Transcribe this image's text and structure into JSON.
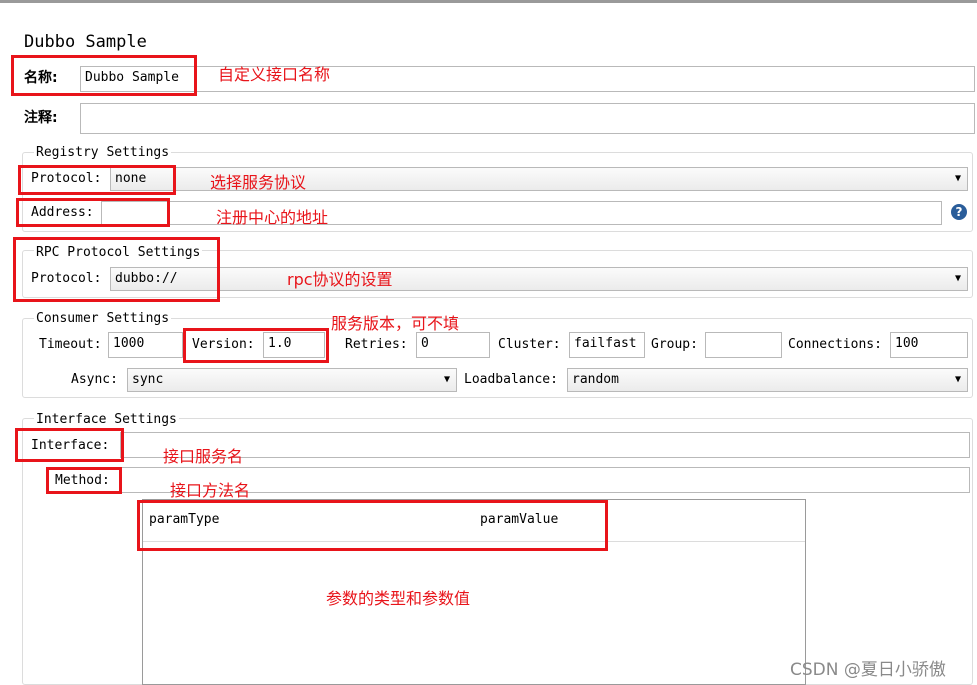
{
  "header": {
    "title": "Dubbo Sample"
  },
  "name": {
    "label": "名称:",
    "value": "Dubbo Sample"
  },
  "comment": {
    "label": "注释:",
    "value": ""
  },
  "registry": {
    "title": "Registry Settings",
    "protocol_label": "Protocol:",
    "protocol_value": "none",
    "address_label": "Address:",
    "address_value": ""
  },
  "rpc": {
    "title": "RPC Protocol Settings",
    "protocol_label": "Protocol:",
    "protocol_value": "dubbo://"
  },
  "consumer": {
    "title": "Consumer Settings",
    "timeout_label": "Timeout:",
    "timeout_value": "1000",
    "version_label": "Version:",
    "version_value": "1.0",
    "retries_label": "Retries:",
    "retries_value": "0",
    "cluster_label": "Cluster:",
    "cluster_value": "failfast",
    "group_label": "Group:",
    "group_value": "",
    "connections_label": "Connections:",
    "connections_value": "100",
    "async_label": "Async:",
    "async_value": "sync",
    "loadbalance_label": "Loadbalance:",
    "loadbalance_value": "random"
  },
  "interface_settings": {
    "title": "Interface Settings",
    "interface_label": "Interface:",
    "interface_value": "",
    "method_label": "Method:",
    "method_value": ""
  },
  "param_table": {
    "columns": [
      "paramType",
      "paramValue"
    ]
  },
  "annotations": {
    "name": "自定义接口名称",
    "protocol": "选择服务协议",
    "address": "注册中心的地址",
    "rpc": "rpc协议的设置",
    "version": "服务版本，可不填",
    "interface": "接口服务名",
    "method": "接口方法名",
    "params": "参数的类型和参数值"
  },
  "watermark": "CSDN @夏日小骄傲",
  "colors": {
    "annotation_red": "#e8141a",
    "help_blue": "#2a5d9a"
  },
  "icons": {
    "help": "question-circle-icon",
    "dropdown": "chevron-down-icon"
  }
}
